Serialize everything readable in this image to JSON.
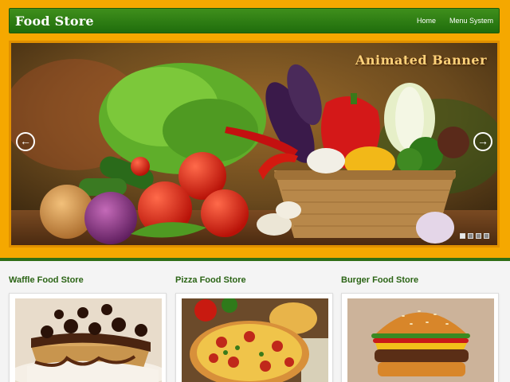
{
  "header": {
    "brand": "Food Store",
    "nav": [
      {
        "label": "Home"
      },
      {
        "label": "Menu System"
      }
    ]
  },
  "banner": {
    "title": "Animated Banner",
    "prev_icon": "arrow-left-icon",
    "next_icon": "arrow-right-icon",
    "slide_count": 4,
    "active_slide": 1
  },
  "stores": [
    {
      "title": "Waffle Food Store",
      "image": "waffle-photo"
    },
    {
      "title": "Pizza Food Store",
      "image": "pizza-photo"
    },
    {
      "title": "Burger Food Store",
      "image": "burger-photo"
    }
  ],
  "colors": {
    "header_band": "#f5a800",
    "navbar": "#2e7d14",
    "store_title": "#2b6415"
  }
}
